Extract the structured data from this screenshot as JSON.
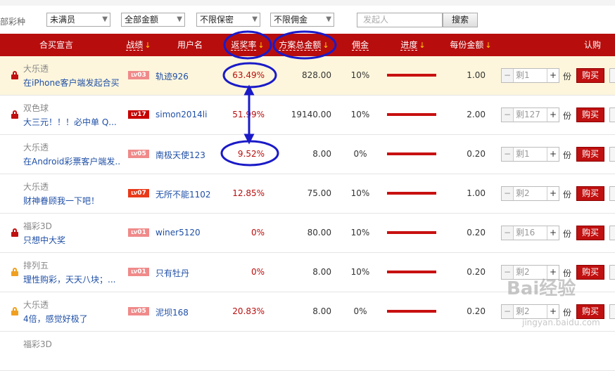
{
  "filters": {
    "type_label": "部彩种",
    "selects": [
      {
        "value": "未满员"
      },
      {
        "value": "全部金额"
      },
      {
        "value": "不限保密"
      },
      {
        "value": "不限佣金"
      }
    ],
    "search_placeholder": "发起人",
    "search_button": "搜索"
  },
  "columns": {
    "slogan": "合买宣言",
    "record": "战绩",
    "username": "用户名",
    "return_rate": "返奖率",
    "total_amount": "方案总金额",
    "commission": "佣金",
    "progress": "进度",
    "per_share": "每份金额",
    "subscribe": "认购",
    "sort_arrow": "↓"
  },
  "rows": [
    {
      "lottery": "大乐透",
      "slogan": "在iPhone客户端发起合买",
      "level": "03",
      "level_prefix": "LV",
      "level_color": "#f08a8a",
      "username": "轨迹926",
      "return_rate": "63.49%",
      "total": "828.00",
      "commission": "10%",
      "progress": 1.0,
      "per_share": "1.00",
      "remaining": "剩1",
      "unit": "份",
      "buy": "购买",
      "locked": true,
      "lock_color": "#c01010"
    },
    {
      "lottery": "双色球",
      "slogan": "大三元！！！必中单 Q...",
      "level": "17",
      "level_prefix": "LV",
      "level_color": "#c80000",
      "username": "simon2014li",
      "return_rate": "51.99%",
      "total": "19140.00",
      "commission": "10%",
      "progress": 1.0,
      "per_share": "2.00",
      "remaining": "剩127",
      "unit": "份",
      "buy": "购买",
      "locked": true,
      "lock_color": "#c01010"
    },
    {
      "lottery": "大乐透",
      "slogan": "在Android彩票客户端发...",
      "level": "05",
      "level_prefix": "LV",
      "level_color": "#f08a8a",
      "username": "南极天使123",
      "return_rate": "9.52%",
      "total": "8.00",
      "commission": "0%",
      "progress": 1.0,
      "per_share": "0.20",
      "remaining": "剩1",
      "unit": "份",
      "buy": "购买",
      "locked": false,
      "lock_color": ""
    },
    {
      "lottery": "大乐透",
      "slogan": "财神眷顾我一下吧！",
      "level": "07",
      "level_prefix": "LV",
      "level_color": "#e83a1a",
      "username": "无所不能1102",
      "return_rate": "12.85%",
      "total": "75.00",
      "commission": "10%",
      "progress": 1.0,
      "per_share": "1.00",
      "remaining": "剩2",
      "unit": "份",
      "buy": "购买",
      "locked": false,
      "lock_color": ""
    },
    {
      "lottery": "福彩3D",
      "slogan": "只想中大奖",
      "level": "01",
      "level_prefix": "LV",
      "level_color": "#f08a8a",
      "username": "winer5120",
      "return_rate": "0%",
      "total": "80.00",
      "commission": "10%",
      "progress": 1.0,
      "per_share": "0.20",
      "remaining": "剩16",
      "unit": "份",
      "buy": "购买",
      "locked": true,
      "lock_color": "#c01010"
    },
    {
      "lottery": "排列五",
      "slogan": "理性购彩，天天八块；...",
      "level": "01",
      "level_prefix": "LV",
      "level_color": "#f08a8a",
      "username": "只有牡丹",
      "return_rate": "0%",
      "total": "8.00",
      "commission": "10%",
      "progress": 1.0,
      "per_share": "0.20",
      "remaining": "剩2",
      "unit": "份",
      "buy": "购买",
      "locked": true,
      "lock_color": "#f0a020"
    },
    {
      "lottery": "大乐透",
      "slogan": "4倍，感觉好极了",
      "level": "05",
      "level_prefix": "LV",
      "level_color": "#f08a8a",
      "username": "泥坝168",
      "return_rate": "20.83%",
      "total": "8.00",
      "commission": "0%",
      "progress": 1.0,
      "per_share": "0.20",
      "remaining": "剩2",
      "unit": "份",
      "buy": "购买",
      "locked": true,
      "lock_color": "#f0a020"
    },
    {
      "lottery": "福彩3D",
      "slogan": "",
      "level": "",
      "level_prefix": "",
      "level_color": "",
      "username": "",
      "return_rate": "",
      "total": "",
      "commission": "",
      "progress": 0,
      "per_share": "",
      "remaining": "",
      "unit": "",
      "buy": "",
      "locked": false,
      "lock_color": ""
    }
  ],
  "watermark": {
    "main": "Bai经验",
    "sub": "jingyan.baidu.com"
  },
  "colors": {
    "header_bg": "#b80d0d",
    "annotation": "#1a1ac8",
    "highlight_row": "#fdf6dc"
  }
}
